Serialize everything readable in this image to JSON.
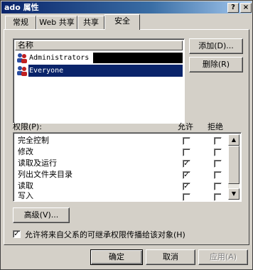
{
  "window": {
    "title": "ado 属性",
    "help_glyph": "?",
    "close_glyph": "×"
  },
  "tabs": [
    {
      "label": "常规"
    },
    {
      "label": "Web 共享"
    },
    {
      "label": "共享"
    },
    {
      "label": "安全"
    }
  ],
  "names_section": {
    "header": "名称",
    "users": [
      {
        "name": "Administrators",
        "selected": false,
        "icon": "users-group-icon"
      },
      {
        "name": "Everyone",
        "selected": true,
        "icon": "users-group-icon"
      }
    ],
    "add_button": "添加(D)...",
    "remove_button": "删除(R)"
  },
  "permissions": {
    "label": "权限(P):",
    "allow_header": "允许",
    "deny_header": "拒绝",
    "rows": [
      {
        "name": "完全控制",
        "allow": false,
        "deny": false
      },
      {
        "name": "修改",
        "allow": false,
        "deny": false
      },
      {
        "name": "读取及运行",
        "allow": true,
        "deny": false
      },
      {
        "name": "列出文件夹目录",
        "allow": true,
        "deny": false
      },
      {
        "name": "读取",
        "allow": true,
        "deny": false
      },
      {
        "name": "写入",
        "allow": false,
        "deny": false
      }
    ]
  },
  "advanced_button": "高级(V)...",
  "inherit_checkbox": {
    "label": "允许将来自父系的可继承权限传播给该对象(H)",
    "checked": true
  },
  "footer": {
    "ok": "确定",
    "cancel": "取消",
    "apply": "应用(A)"
  },
  "colors": {
    "selection": "#0a246a",
    "face": "#d4d0c8",
    "redaction": "#000000"
  }
}
